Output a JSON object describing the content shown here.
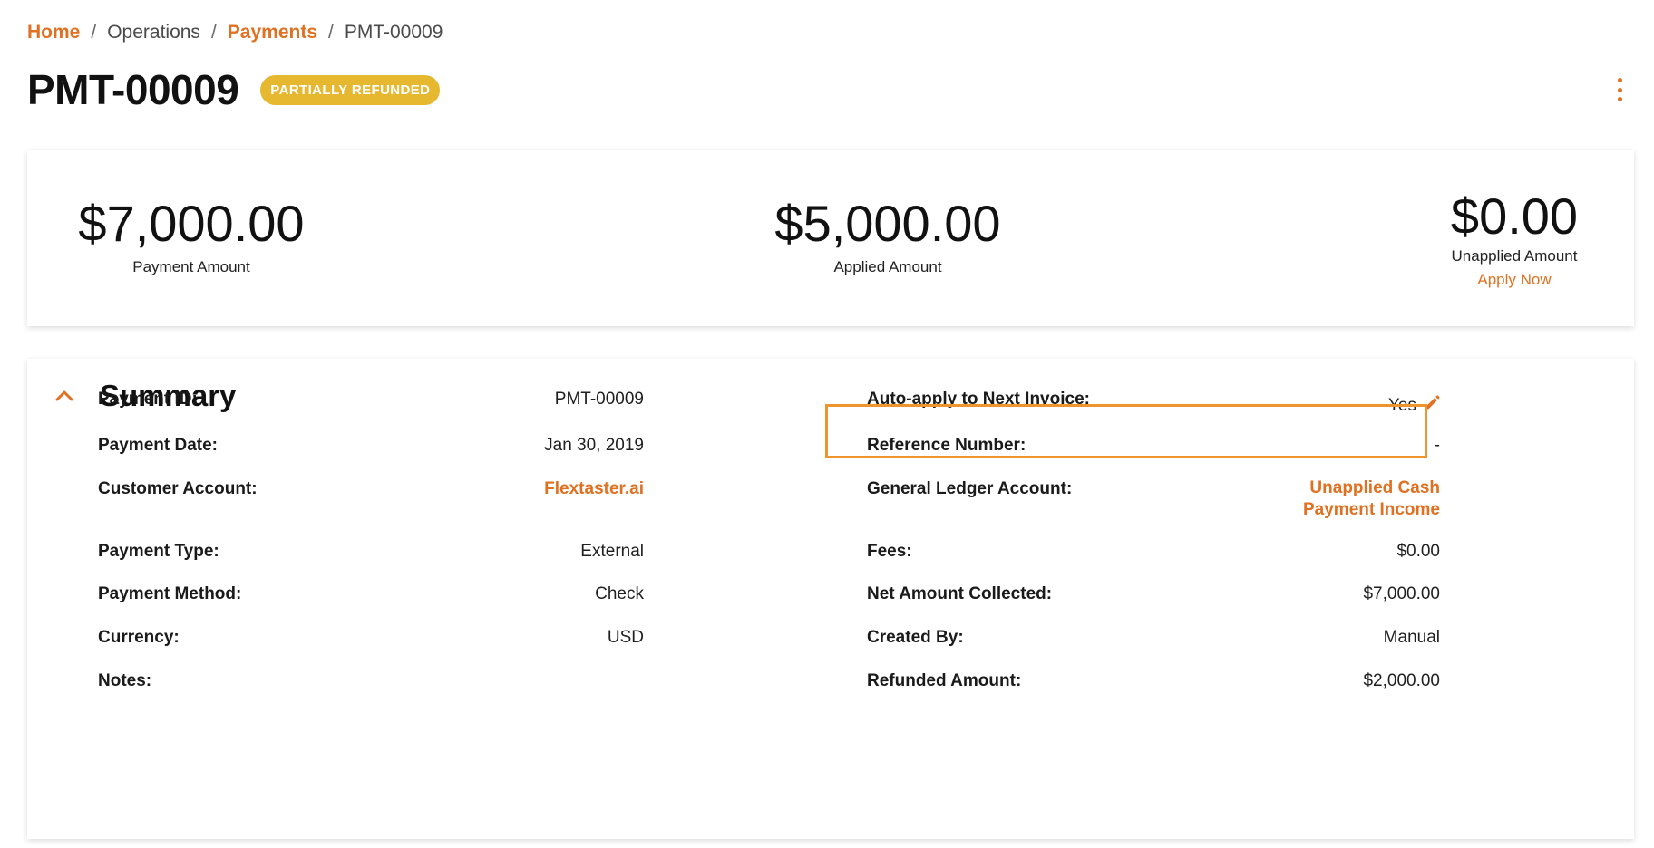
{
  "breadcrumb": {
    "home": "Home",
    "operations": "Operations",
    "payments": "Payments",
    "current": "PMT-00009",
    "separator": "/"
  },
  "header": {
    "title": "PMT-00009",
    "status": "PARTIALLY REFUNDED"
  },
  "amounts": {
    "payment": {
      "value": "$7,000.00",
      "label": "Payment Amount"
    },
    "applied": {
      "value": "$5,000.00",
      "label": "Applied Amount"
    },
    "unapplied": {
      "value": "$0.00",
      "label": "Unapplied Amount",
      "action": "Apply Now"
    }
  },
  "summary": {
    "title": "Summary",
    "left": [
      {
        "label": "Payment ID:",
        "value": "PMT-00009"
      },
      {
        "label": "Payment Date:",
        "value": "Jan 30, 2019"
      },
      {
        "label": "Customer Account:",
        "value": "Flextaster.ai"
      },
      {
        "label": "Payment Type:",
        "value": "External"
      },
      {
        "label": "Payment Method:",
        "value": "Check"
      },
      {
        "label": "Currency:",
        "value": "USD"
      },
      {
        "label": "Notes:",
        "value": ""
      }
    ],
    "right": [
      {
        "label": "Auto-apply to Next Invoice:",
        "value": "Yes"
      },
      {
        "label": "Reference Number:",
        "value": "-"
      },
      {
        "label": "General Ledger Account:",
        "value": "Unapplied Cash",
        "value2": "Payment Income"
      },
      {
        "label": "Fees:",
        "value": "$0.00"
      },
      {
        "label": "Net Amount Collected:",
        "value": "$7,000.00"
      },
      {
        "label": "Created By:",
        "value": "Manual"
      },
      {
        "label": "Refunded Amount:",
        "value": "$2,000.00"
      }
    ]
  },
  "colors": {
    "accent": "#e07122",
    "badge": "#e6b830",
    "highlight": "#f0952e"
  },
  "icons": {
    "kebab": "kebab-menu-icon",
    "collapse": "chevron-up-icon",
    "edit": "pencil-icon"
  }
}
